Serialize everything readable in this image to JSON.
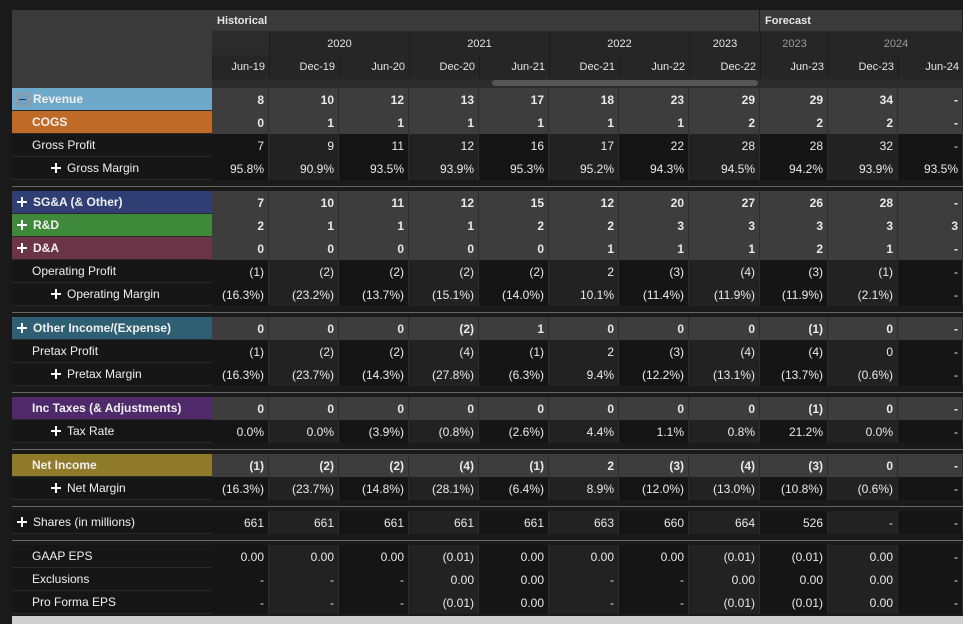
{
  "header": {
    "groups": [
      {
        "label": "Historical"
      },
      {
        "label": "Forecast"
      }
    ],
    "years": [
      "2020",
      "2021",
      "2022",
      "2023",
      "2023",
      "2024"
    ],
    "periods": [
      "Jun-19",
      "Dec-19",
      "Jun-20",
      "Dec-20",
      "Jun-21",
      "Dec-21",
      "Jun-22",
      "Dec-22",
      "Jun-23",
      "Dec-23",
      "Jun-24"
    ]
  },
  "colors": {
    "revenue": "#6fa9c9",
    "cogs": "#c06a27",
    "sga": "#2f3f73",
    "rnd": "#3e8a3a",
    "da": "#6b3447",
    "other_income": "#2f5f73",
    "taxes": "#4e2a6a",
    "net_income": "#8f7a2a"
  },
  "rows": [
    {
      "label": "Revenue",
      "values": [
        "8",
        "10",
        "12",
        "13",
        "17",
        "18",
        "23",
        "29",
        "29",
        "34",
        "-"
      ]
    },
    {
      "label": "COGS",
      "values": [
        "0",
        "1",
        "1",
        "1",
        "1",
        "1",
        "1",
        "2",
        "2",
        "2",
        "-"
      ]
    },
    {
      "label": "Gross Profit",
      "values": [
        "7",
        "9",
        "11",
        "12",
        "16",
        "17",
        "22",
        "28",
        "28",
        "32",
        "-"
      ]
    },
    {
      "label": "Gross Margin",
      "values": [
        "95.8%",
        "90.9%",
        "93.5%",
        "93.9%",
        "95.3%",
        "95.2%",
        "94.3%",
        "94.5%",
        "94.2%",
        "93.9%",
        "93.5%"
      ]
    },
    {
      "label": "SG&A (& Other)",
      "values": [
        "7",
        "10",
        "11",
        "12",
        "15",
        "12",
        "20",
        "27",
        "26",
        "28",
        "-"
      ]
    },
    {
      "label": "R&D",
      "values": [
        "2",
        "1",
        "1",
        "1",
        "2",
        "2",
        "3",
        "3",
        "3",
        "3",
        "3"
      ]
    },
    {
      "label": "D&A",
      "values": [
        "0",
        "0",
        "0",
        "0",
        "0",
        "1",
        "1",
        "1",
        "2",
        "1",
        "-"
      ]
    },
    {
      "label": "Operating Profit",
      "values": [
        "(1)",
        "(2)",
        "(2)",
        "(2)",
        "(2)",
        "2",
        "(3)",
        "(4)",
        "(3)",
        "(1)",
        "-"
      ]
    },
    {
      "label": "Operating Margin",
      "values": [
        "(16.3%)",
        "(23.2%)",
        "(13.7%)",
        "(15.1%)",
        "(14.0%)",
        "10.1%",
        "(11.4%)",
        "(11.9%)",
        "(11.9%)",
        "(2.1%)",
        "-"
      ]
    },
    {
      "label": "Other Income/(Expense)",
      "values": [
        "0",
        "0",
        "0",
        "(2)",
        "1",
        "0",
        "0",
        "0",
        "(1)",
        "0",
        "-"
      ]
    },
    {
      "label": "Pretax Profit",
      "values": [
        "(1)",
        "(2)",
        "(2)",
        "(4)",
        "(1)",
        "2",
        "(3)",
        "(4)",
        "(4)",
        "0",
        "-"
      ]
    },
    {
      "label": "Pretax Margin",
      "values": [
        "(16.3%)",
        "(23.7%)",
        "(14.3%)",
        "(27.8%)",
        "(6.3%)",
        "9.4%",
        "(12.2%)",
        "(13.1%)",
        "(13.7%)",
        "(0.6%)",
        "-"
      ]
    },
    {
      "label": "Inc Taxes (& Adjustments)",
      "values": [
        "0",
        "0",
        "0",
        "0",
        "0",
        "0",
        "0",
        "0",
        "(1)",
        "0",
        "-"
      ]
    },
    {
      "label": "Tax Rate",
      "values": [
        "0.0%",
        "0.0%",
        "(3.9%)",
        "(0.8%)",
        "(2.6%)",
        "4.4%",
        "1.1%",
        "0.8%",
        "21.2%",
        "0.0%",
        "-"
      ]
    },
    {
      "label": "Net Income",
      "values": [
        "(1)",
        "(2)",
        "(2)",
        "(4)",
        "(1)",
        "2",
        "(3)",
        "(4)",
        "(3)",
        "0",
        "-"
      ]
    },
    {
      "label": "Net Margin",
      "values": [
        "(16.3%)",
        "(23.7%)",
        "(14.8%)",
        "(28.1%)",
        "(6.4%)",
        "8.9%",
        "(12.0%)",
        "(13.0%)",
        "(10.8%)",
        "(0.6%)",
        "-"
      ]
    },
    {
      "label": "Shares (in millions)",
      "values": [
        "661",
        "661",
        "661",
        "661",
        "661",
        "663",
        "660",
        "664",
        "526",
        "-",
        "-"
      ]
    },
    {
      "label": "GAAP EPS",
      "values": [
        "0.00",
        "0.00",
        "0.00",
        "(0.01)",
        "0.00",
        "0.00",
        "0.00",
        "(0.01)",
        "(0.01)",
        "0.00",
        "-"
      ]
    },
    {
      "label": "Exclusions",
      "values": [
        "-",
        "-",
        "-",
        "0.00",
        "0.00",
        "-",
        "-",
        "0.00",
        "0.00",
        "0.00",
        "-"
      ]
    },
    {
      "label": "Pro Forma EPS",
      "values": [
        "-",
        "-",
        "-",
        "(0.01)",
        "0.00",
        "-",
        "-",
        "(0.01)",
        "(0.01)",
        "0.00",
        "-"
      ]
    }
  ]
}
